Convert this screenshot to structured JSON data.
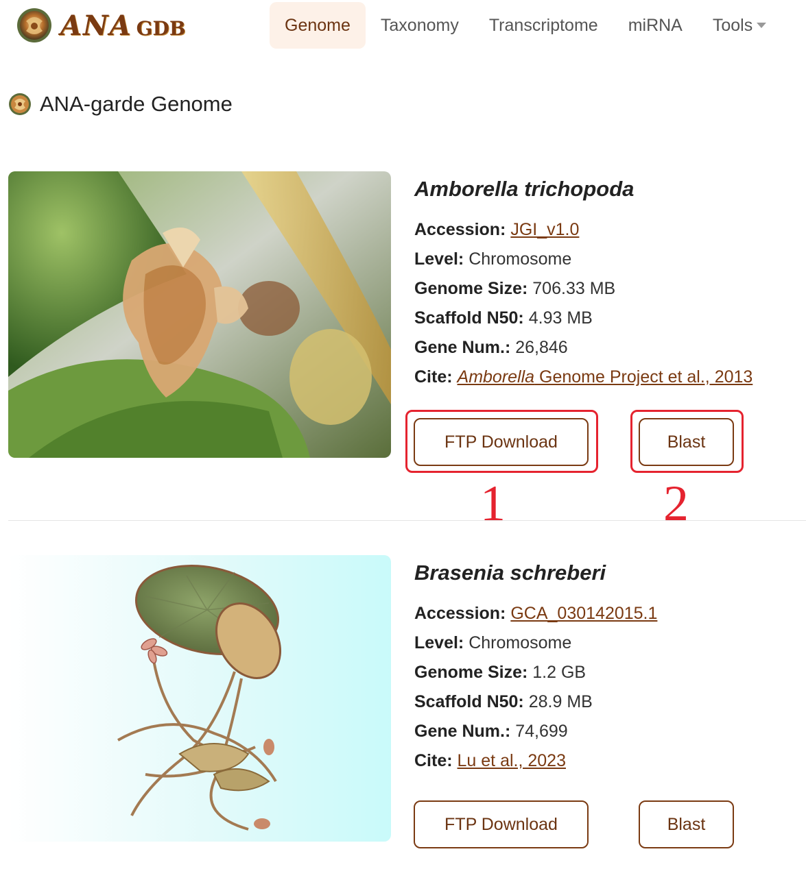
{
  "header": {
    "logo": {
      "ana": "ANA",
      "gdb": "GDB",
      "icon": "flower-logo-icon"
    },
    "nav": [
      {
        "label": "Genome",
        "active": true
      },
      {
        "label": "Taxonomy"
      },
      {
        "label": "Transcriptome"
      },
      {
        "label": "miRNA"
      },
      {
        "label": "Tools",
        "has_dropdown": true
      }
    ]
  },
  "section": {
    "title": "ANA-garde Genome",
    "icon": "flower-logo-icon"
  },
  "genomes": [
    {
      "species": "Amborella trichopoda",
      "accession_label": "Accession:",
      "accession": "JGI_v1.0",
      "level_label": "Level:",
      "level": "Chromosome",
      "size_label": "Genome Size:",
      "size": "706.33 MB",
      "n50_label": "Scaffold N50:",
      "n50": "4.93 MB",
      "gene_label": "Gene Num.:",
      "gene_num": "26,846",
      "cite_label": "Cite:",
      "cite_italic": "Amborella",
      "cite_rest": " Genome Project et al., 2013",
      "ftp_label": "FTP Download",
      "blast_label": "Blast"
    },
    {
      "species": "Brasenia schreberi",
      "accession_label": "Accession:",
      "accession": "GCA_030142015.1",
      "level_label": "Level:",
      "level": "Chromosome",
      "size_label": "Genome Size:",
      "size": "1.2 GB",
      "n50_label": "Scaffold N50:",
      "n50": "28.9 MB",
      "gene_label": "Gene Num.:",
      "gene_num": "74,699",
      "cite_label": "Cite:",
      "cite_italic": "",
      "cite_rest": "Lu et al., 2023",
      "ftp_label": "FTP Download",
      "blast_label": "Blast"
    }
  ],
  "annotations": {
    "first": "1",
    "second": "2",
    "color": "#e5232f"
  },
  "colors": {
    "brand": "#7a3a12",
    "active_nav_bg": "#fdf1e8"
  }
}
